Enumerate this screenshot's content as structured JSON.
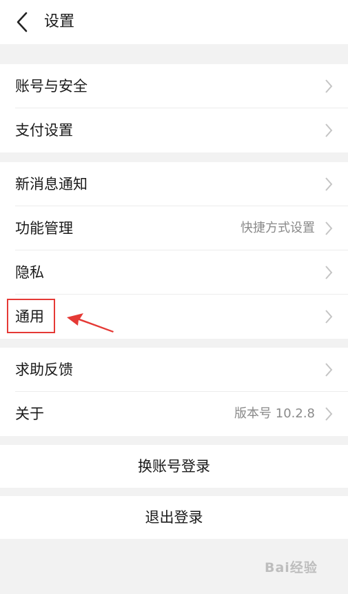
{
  "header": {
    "title": "设置",
    "back_icon": "chevron-left-icon"
  },
  "groups": [
    {
      "items": [
        {
          "label": "账号与安全"
        },
        {
          "label": "支付设置"
        }
      ]
    },
    {
      "items": [
        {
          "label": "新消息通知"
        },
        {
          "label": "功能管理",
          "value": "快捷方式设置"
        },
        {
          "label": "隐私"
        },
        {
          "label": "通用"
        }
      ]
    },
    {
      "items": [
        {
          "label": "求助反馈"
        },
        {
          "label": "关于",
          "value": "版本号 10.2.8"
        }
      ]
    }
  ],
  "actions": {
    "switch_account": "换账号登录",
    "logout": "退出登录"
  },
  "watermark": "Bai经验",
  "colors": {
    "background": "#f2f2f2",
    "annotation_red": "#e53935",
    "muted_text": "#8a8a8a"
  }
}
